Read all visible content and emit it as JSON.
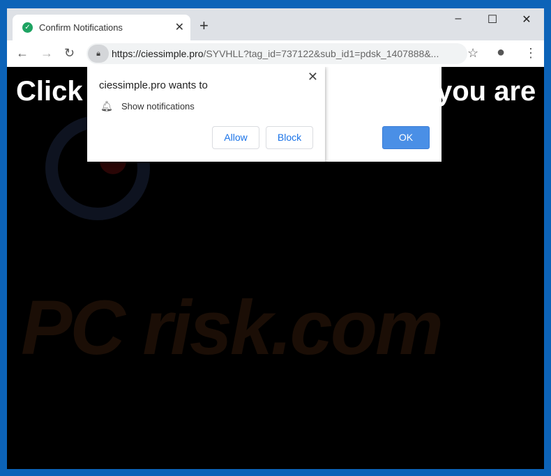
{
  "tab": {
    "title": "Confirm Notifications",
    "favicon": "check-circle-icon",
    "color": "#1ea362"
  },
  "toolbar": {
    "url_host": "https://ciessimple.pro",
    "url_rest": "/SYVHLL?tag_id=737122&sub_id1=pdsk_1407888&..."
  },
  "page": {
    "heading_left": "Click",
    "heading_right": "you are",
    "watermark": "PC risk.com"
  },
  "alert": {
    "ok_label": "OK"
  },
  "permission_dialog": {
    "title": "ciessimple.pro wants to",
    "permission": "Show notifications",
    "allow_label": "Allow",
    "block_label": "Block"
  }
}
